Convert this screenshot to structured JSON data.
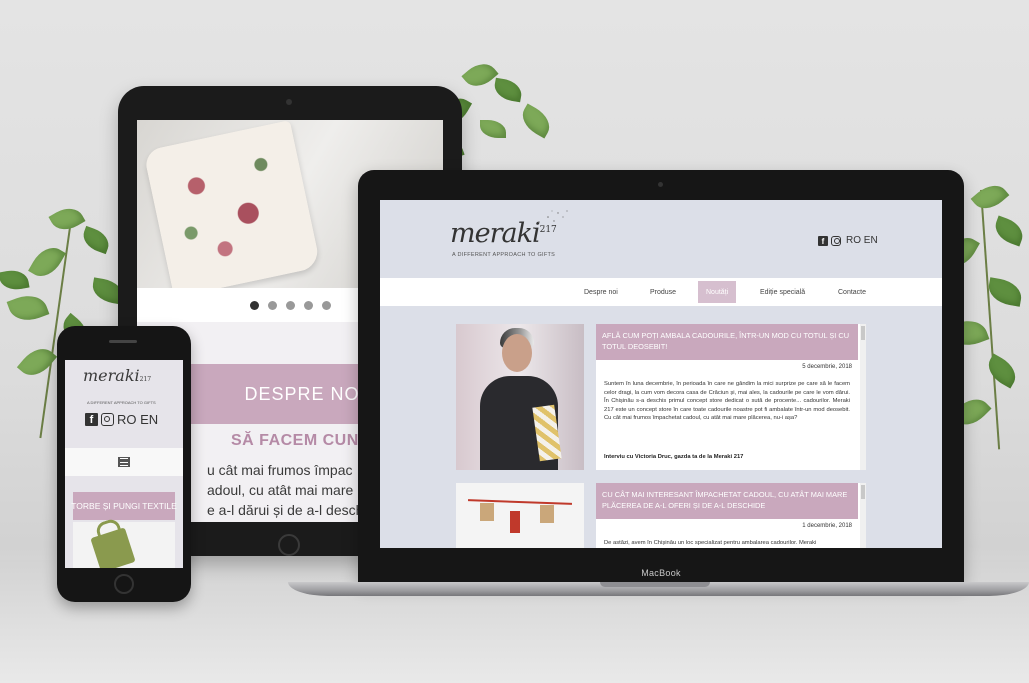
{
  "tablet": {
    "banner": "DESPRE NOI",
    "subheading": "SĂ FACEM CUNOȘTINȚ",
    "paragraph": [
      "u cât mai frumos împac",
      "adoul, cu atât mai mare p",
      "e a-l dărui și de a-l desch"
    ],
    "slider_dots": 5,
    "active_dot": 0
  },
  "phone": {
    "logo": "meraki",
    "logo_number": "217",
    "tagline": "A DIFFERENT APPROACH TO GIFTS",
    "languages": "RO EN",
    "category": "TORBE ȘI PUNGI TEXTILE"
  },
  "laptop": {
    "brand": "MacBook",
    "site": {
      "logo": "meraki",
      "logo_number": "217",
      "tagline": "A DIFFERENT APPROACH TO GIFTS",
      "languages": "RO EN",
      "nav": [
        "Despre noi",
        "Produse",
        "Noutăți",
        "Ediție specială",
        "Contacte"
      ],
      "active_nav": "Noutăți",
      "articles": [
        {
          "title": "AFLĂ CUM POȚI AMBALA CADOURILE, ÎNTR-UN MOD CU TOTUL ȘI CU TOTUL DEOSEBIT!",
          "date": "5 decembrie, 2018",
          "text": "Suntem în luna decembrie, în perioada în care ne gândim la mici surprize pe care să le facem celor dragi, la cum vom decora casa de Crăciun și, mai ales, la cadourile pe care le vom dărui. În Chișinău s-a deschis primul concept store dedicat o sută de procente... cadourilor. Meraki 217 este un concept store în care toate cadourile noastre pot fi ambalate într-un mod deosebit. Cu cât mai frumos împachetat cadoul, cu atât mai mare plăcerea, nu-i așa?",
          "link": "Interviu cu Victoria Druc, gazda ta de la Meraki 217"
        },
        {
          "title": "CU CÂT MAI INTERESANT ÎMPACHETAT CADOUL, CU ATÂT MAI MARE PLĂCEREA DE A-L OFERI ȘI DE A-L DESCHIDE",
          "date": "1 decembrie, 2018",
          "text": "De astăzi, avem în Chișinău un loc specializat pentru ambalarea cadourilor. Meraki"
        }
      ]
    }
  },
  "colors": {
    "accent_pink": "#c9a8bd",
    "site_bg": "#dcdfe8",
    "device_black": "#161616"
  }
}
